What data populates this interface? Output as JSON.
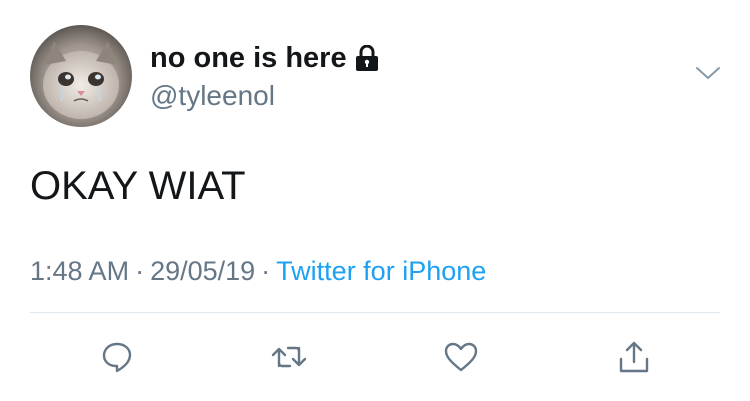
{
  "user": {
    "display_name": "no one is here",
    "handle": "@tyleenol",
    "avatar": "crying-cat-avatar",
    "protected_icon": "lock-icon"
  },
  "tweet": {
    "text": "OKAY WIAT",
    "time": "1:48 AM",
    "date": "29/05/19",
    "separator": "·",
    "source": "Twitter for iPhone"
  },
  "actions": {
    "reply_icon": "reply-icon",
    "retweet_icon": "retweet-icon",
    "like_icon": "like-icon",
    "share_icon": "share-icon"
  },
  "colors": {
    "text": "#14171a",
    "secondary": "#657786",
    "link": "#1da1f2",
    "divider": "#e1e8ed"
  }
}
